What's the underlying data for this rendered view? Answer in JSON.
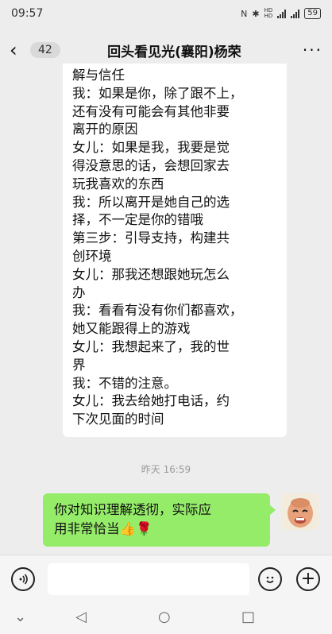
{
  "status": {
    "time": "09:57",
    "indicators": "N ✱ HD HD 4G 4G",
    "battery": "59"
  },
  "header": {
    "back_icon": "‹",
    "unread_count": "42",
    "title": "回头看见光(襄阳)杨荣",
    "more_icon": "···"
  },
  "messages": {
    "received_lines": [
      "解与信任",
      "我：如果是你，除了跟不上，",
      "还有没有可能会有其他非要",
      "离开的原因",
      "女儿：如果是我，我要是觉",
      "得没意思的话，会想回家去",
      "玩我喜欢的东西",
      "我：所以离开是她自己的选",
      "择，不一定是你的错哦",
      "第三步：引导支持，构建共",
      "创环境",
      "女儿：那我还想跟她玩怎么",
      "办",
      "我：看看有没有你们都喜欢，",
      "她又能跟得上的游戏",
      "女儿：我想起来了，我的世",
      "界",
      "我：不错的注意。",
      "女儿：我去给她打电话，约",
      "下次见面的时间"
    ],
    "timestamp": "昨天 16:59",
    "sent_line_1": "你对知识理解透彻，实际应",
    "sent_line_2": "用非常恰当👍🌹"
  },
  "inputbar": {
    "voice_icon": "voice-icon",
    "emoji_icon": "emoji-icon",
    "plus_icon": "+"
  },
  "nav": {
    "collapse": "⌄",
    "back": "◁",
    "home": "○",
    "recents": "□"
  }
}
